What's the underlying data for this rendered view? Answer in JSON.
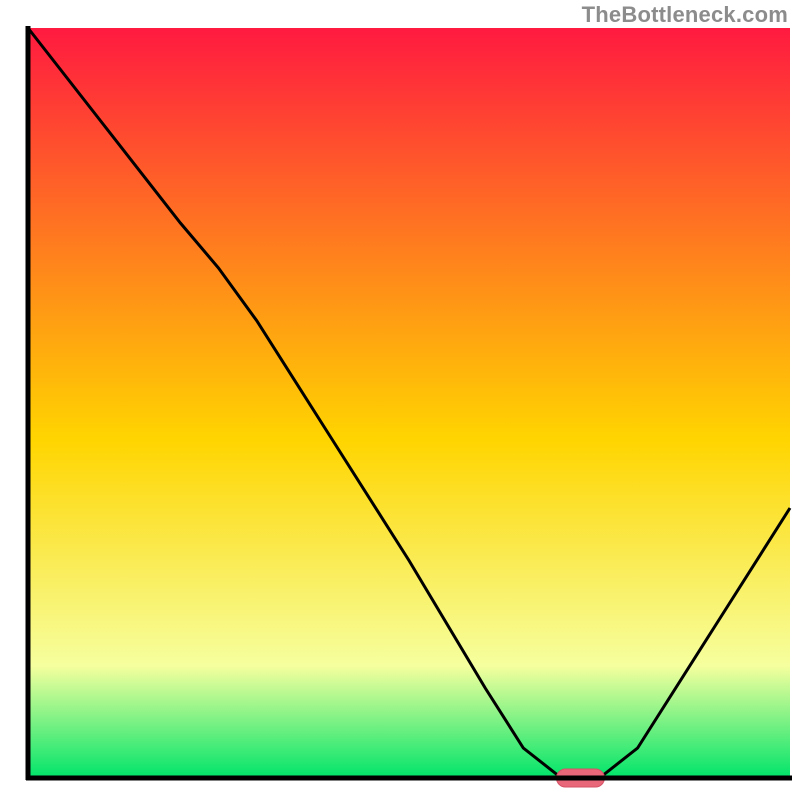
{
  "watermark": "TheBottleneck.com",
  "chart_data": {
    "type": "line",
    "title": "",
    "xlabel": "",
    "ylabel": "",
    "xlim": [
      0,
      100
    ],
    "ylim": [
      0,
      100
    ],
    "series": [
      {
        "name": "bottleneck-curve",
        "x": [
          0,
          10,
          20,
          25,
          30,
          40,
          50,
          60,
          65,
          70,
          75,
          80,
          90,
          100
        ],
        "values": [
          100,
          87,
          74,
          68,
          61,
          45,
          29,
          12,
          4,
          0,
          0,
          4,
          20,
          36
        ]
      }
    ],
    "marker": {
      "name": "selected-point",
      "x": 72.5,
      "y": 0
    },
    "colors": {
      "gradient_top": "#ff1a40",
      "gradient_mid": "#ffd500",
      "gradient_low": "#f6ff9e",
      "gradient_bottom": "#00e46a",
      "curve": "#000000",
      "axis": "#000000",
      "marker_fill": "#e8687a",
      "marker_stroke": "#d65266"
    }
  }
}
